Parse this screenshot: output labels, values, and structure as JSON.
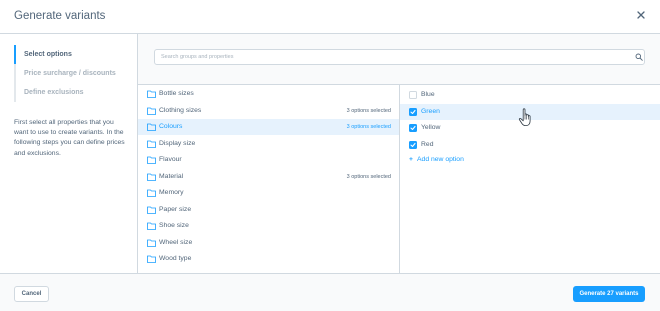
{
  "modal": {
    "title": "Generate variants",
    "close_icon": "close-icon"
  },
  "sidebar": {
    "steps": [
      {
        "label": "Select options",
        "active": true
      },
      {
        "label": "Price surcharge / discounts",
        "active": false
      },
      {
        "label": "Define exclusions",
        "active": false
      }
    ],
    "intro": "First select all properties that you want to use to create variants. In the following steps you can define prices and exclusions."
  },
  "search": {
    "placeholder": "Search groups and properties",
    "value": "",
    "icon": "search-icon"
  },
  "groups": [
    {
      "name": "Bottle sizes",
      "count": "",
      "active": false
    },
    {
      "name": "Clothing sizes",
      "count": "3 options selected",
      "active": false
    },
    {
      "name": "Colours",
      "count": "3 options selected",
      "active": true
    },
    {
      "name": "Display size",
      "count": "",
      "active": false
    },
    {
      "name": "Flavour",
      "count": "",
      "active": false
    },
    {
      "name": "Material",
      "count": "3 options selected",
      "active": false
    },
    {
      "name": "Memory",
      "count": "",
      "active": false
    },
    {
      "name": "Paper size",
      "count": "",
      "active": false
    },
    {
      "name": "Shoe size",
      "count": "",
      "active": false
    },
    {
      "name": "Wheel size",
      "count": "",
      "active": false
    },
    {
      "name": "Wood type",
      "count": "",
      "active": false
    }
  ],
  "options": [
    {
      "label": "Blue",
      "checked": false,
      "active": false
    },
    {
      "label": "Green",
      "checked": true,
      "active": true
    },
    {
      "label": "Yellow",
      "checked": true,
      "active": false
    },
    {
      "label": "Red",
      "checked": true,
      "active": false
    }
  ],
  "add_option_label": "Add new option",
  "footer": {
    "cancel_label": "Cancel",
    "generate_label": "Generate 27 variants"
  },
  "colors": {
    "accent": "#189eff",
    "text": "#52667a",
    "border": "#d1d9e0",
    "highlight": "#e6f2fd"
  }
}
